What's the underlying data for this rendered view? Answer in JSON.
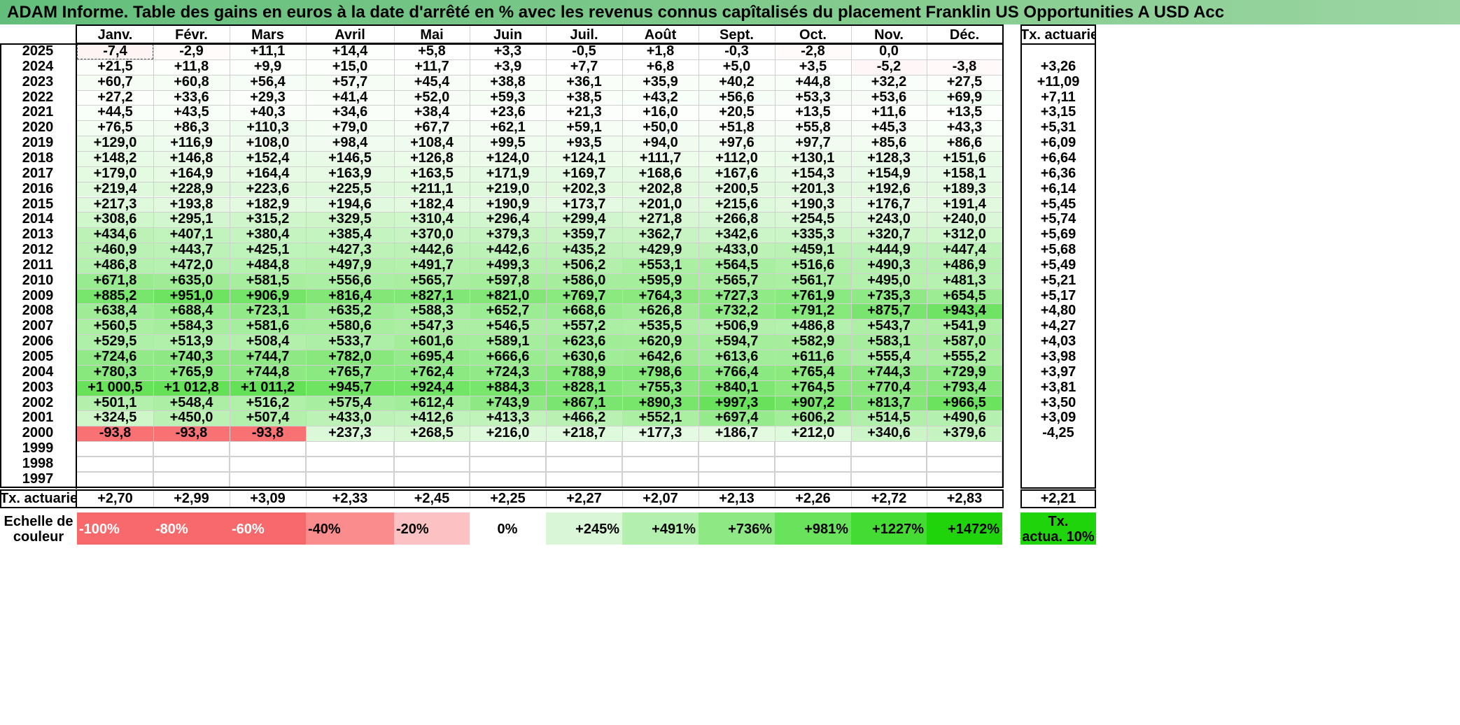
{
  "title": "ADAM Informe. Table des gains en euros à la date d'arrêté en % avec les revenus connus capîtalisés du placement Franklin US Opportunities A USD Acc",
  "months": [
    "Janv.",
    "Févr.",
    "Mars",
    "Avril",
    "Mai",
    "Juin",
    "Juil.",
    "Août",
    "Sept.",
    "Oct.",
    "Nov.",
    "Déc."
  ],
  "tx_header": "Tx. actuariel",
  "rows": [
    {
      "year": "2025",
      "values": [
        "-7,4",
        "-2,9",
        "+11,1",
        "+14,4",
        "+5,8",
        "+3,3",
        "-0,5",
        "+1,8",
        "-0,3",
        "-2,8",
        "0,0",
        ""
      ],
      "tx": ""
    },
    {
      "year": "2024",
      "values": [
        "+21,5",
        "+11,8",
        "+9,9",
        "+15,0",
        "+11,7",
        "+3,9",
        "+7,7",
        "+6,8",
        "+5,0",
        "+3,5",
        "-5,2",
        "-3,8"
      ],
      "tx": "+3,26"
    },
    {
      "year": "2023",
      "values": [
        "+60,7",
        "+60,8",
        "+56,4",
        "+57,7",
        "+45,4",
        "+38,8",
        "+36,1",
        "+35,9",
        "+40,2",
        "+44,8",
        "+32,2",
        "+27,5"
      ],
      "tx": "+11,09"
    },
    {
      "year": "2022",
      "values": [
        "+27,2",
        "+33,6",
        "+29,3",
        "+41,4",
        "+52,0",
        "+59,3",
        "+38,5",
        "+43,2",
        "+56,6",
        "+53,3",
        "+53,6",
        "+69,9"
      ],
      "tx": "+7,11"
    },
    {
      "year": "2021",
      "values": [
        "+44,5",
        "+43,5",
        "+40,3",
        "+34,6",
        "+38,4",
        "+23,6",
        "+21,3",
        "+16,0",
        "+20,5",
        "+13,5",
        "+11,6",
        "+13,5"
      ],
      "tx": "+3,15"
    },
    {
      "year": "2020",
      "values": [
        "+76,5",
        "+86,3",
        "+110,3",
        "+79,0",
        "+67,7",
        "+62,1",
        "+59,1",
        "+50,0",
        "+51,8",
        "+55,8",
        "+45,3",
        "+43,3"
      ],
      "tx": "+5,31"
    },
    {
      "year": "2019",
      "values": [
        "+129,0",
        "+116,9",
        "+108,0",
        "+98,4",
        "+108,4",
        "+99,5",
        "+93,5",
        "+94,0",
        "+97,6",
        "+97,7",
        "+85,6",
        "+86,6"
      ],
      "tx": "+6,09"
    },
    {
      "year": "2018",
      "values": [
        "+148,2",
        "+146,8",
        "+152,4",
        "+146,5",
        "+126,8",
        "+124,0",
        "+124,1",
        "+111,7",
        "+112,0",
        "+130,1",
        "+128,3",
        "+151,6"
      ],
      "tx": "+6,64"
    },
    {
      "year": "2017",
      "values": [
        "+179,0",
        "+164,9",
        "+164,4",
        "+163,9",
        "+163,5",
        "+171,9",
        "+169,7",
        "+168,6",
        "+167,6",
        "+154,3",
        "+154,9",
        "+158,1"
      ],
      "tx": "+6,36"
    },
    {
      "year": "2016",
      "values": [
        "+219,4",
        "+228,9",
        "+223,6",
        "+225,5",
        "+211,1",
        "+219,0",
        "+202,3",
        "+202,8",
        "+200,5",
        "+201,3",
        "+192,6",
        "+189,3"
      ],
      "tx": "+6,14"
    },
    {
      "year": "2015",
      "values": [
        "+217,3",
        "+193,8",
        "+182,9",
        "+194,6",
        "+182,4",
        "+190,9",
        "+173,7",
        "+201,0",
        "+215,6",
        "+190,3",
        "+176,7",
        "+191,4"
      ],
      "tx": "+5,45"
    },
    {
      "year": "2014",
      "values": [
        "+308,6",
        "+295,1",
        "+315,2",
        "+329,5",
        "+310,4",
        "+296,4",
        "+299,4",
        "+271,8",
        "+266,8",
        "+254,5",
        "+243,0",
        "+240,0"
      ],
      "tx": "+5,74"
    },
    {
      "year": "2013",
      "values": [
        "+434,6",
        "+407,1",
        "+380,4",
        "+385,4",
        "+370,0",
        "+379,3",
        "+359,7",
        "+362,7",
        "+342,6",
        "+335,3",
        "+320,7",
        "+312,0"
      ],
      "tx": "+5,69"
    },
    {
      "year": "2012",
      "values": [
        "+460,9",
        "+443,7",
        "+425,1",
        "+427,3",
        "+442,6",
        "+442,6",
        "+435,2",
        "+429,9",
        "+433,0",
        "+459,1",
        "+444,9",
        "+447,4"
      ],
      "tx": "+5,68"
    },
    {
      "year": "2011",
      "values": [
        "+486,8",
        "+472,0",
        "+484,8",
        "+497,9",
        "+491,7",
        "+499,3",
        "+506,2",
        "+553,1",
        "+564,5",
        "+516,6",
        "+490,3",
        "+486,9"
      ],
      "tx": "+5,49"
    },
    {
      "year": "2010",
      "values": [
        "+671,8",
        "+635,0",
        "+581,5",
        "+556,6",
        "+565,7",
        "+597,8",
        "+586,0",
        "+595,9",
        "+565,7",
        "+561,7",
        "+495,0",
        "+481,3"
      ],
      "tx": "+5,21"
    },
    {
      "year": "2009",
      "values": [
        "+885,2",
        "+951,0",
        "+906,9",
        "+816,4",
        "+827,1",
        "+821,0",
        "+769,7",
        "+764,3",
        "+727,3",
        "+761,9",
        "+735,3",
        "+654,5"
      ],
      "tx": "+5,17"
    },
    {
      "year": "2008",
      "values": [
        "+638,4",
        "+688,4",
        "+723,1",
        "+635,2",
        "+588,3",
        "+652,7",
        "+668,6",
        "+626,8",
        "+732,2",
        "+791,2",
        "+875,7",
        "+943,4"
      ],
      "tx": "+4,80"
    },
    {
      "year": "2007",
      "values": [
        "+560,5",
        "+584,3",
        "+581,6",
        "+580,6",
        "+547,3",
        "+546,5",
        "+557,2",
        "+535,5",
        "+506,9",
        "+486,8",
        "+543,7",
        "+541,9"
      ],
      "tx": "+4,27"
    },
    {
      "year": "2006",
      "values": [
        "+529,5",
        "+513,9",
        "+508,4",
        "+533,7",
        "+601,6",
        "+589,1",
        "+623,6",
        "+620,9",
        "+594,7",
        "+582,9",
        "+583,1",
        "+587,0"
      ],
      "tx": "+4,03"
    },
    {
      "year": "2005",
      "values": [
        "+724,6",
        "+740,3",
        "+744,7",
        "+782,0",
        "+695,4",
        "+666,6",
        "+630,6",
        "+642,6",
        "+613,6",
        "+611,6",
        "+555,4",
        "+555,2"
      ],
      "tx": "+3,98"
    },
    {
      "year": "2004",
      "values": [
        "+780,3",
        "+765,9",
        "+744,8",
        "+765,7",
        "+762,4",
        "+724,3",
        "+788,9",
        "+798,6",
        "+766,4",
        "+765,4",
        "+744,3",
        "+729,9"
      ],
      "tx": "+3,97"
    },
    {
      "year": "2003",
      "values": [
        "+1 000,5",
        "+1 012,8",
        "+1 011,2",
        "+945,7",
        "+924,4",
        "+884,3",
        "+828,1",
        "+755,3",
        "+840,1",
        "+764,5",
        "+770,4",
        "+793,4"
      ],
      "tx": "+3,81"
    },
    {
      "year": "2002",
      "values": [
        "+501,1",
        "+548,4",
        "+516,2",
        "+575,4",
        "+612,4",
        "+743,9",
        "+867,1",
        "+890,3",
        "+997,3",
        "+907,2",
        "+813,7",
        "+966,5"
      ],
      "tx": "+3,50"
    },
    {
      "year": "2001",
      "values": [
        "+324,5",
        "+450,0",
        "+507,4",
        "+433,0",
        "+412,6",
        "+413,3",
        "+466,2",
        "+552,1",
        "+697,4",
        "+606,2",
        "+514,5",
        "+490,6"
      ],
      "tx": "+3,09"
    },
    {
      "year": "2000",
      "values": [
        "-93,8",
        "-93,8",
        "-93,8",
        "+237,3",
        "+268,5",
        "+216,0",
        "+218,7",
        "+177,3",
        "+186,7",
        "+212,0",
        "+340,6",
        "+379,6"
      ],
      "tx": "-4,25"
    },
    {
      "year": "1999",
      "values": [
        "",
        "",
        "",
        "",
        "",
        "",
        "",
        "",
        "",
        "",
        "",
        ""
      ],
      "tx": ""
    },
    {
      "year": "1998",
      "values": [
        "",
        "",
        "",
        "",
        "",
        "",
        "",
        "",
        "",
        "",
        "",
        ""
      ],
      "tx": ""
    },
    {
      "year": "1997",
      "values": [
        "",
        "",
        "",
        "",
        "",
        "",
        "",
        "",
        "",
        "",
        "",
        ""
      ],
      "tx": ""
    }
  ],
  "footer": {
    "label": "Tx. actuariel",
    "values": [
      "+2,70",
      "+2,99",
      "+3,09",
      "+2,33",
      "+2,45",
      "+2,25",
      "+2,27",
      "+2,07",
      "+2,13",
      "+2,26",
      "+2,72",
      "+2,83"
    ],
    "tx": "+2,21"
  },
  "scale": {
    "label_line1": "Echelle de",
    "label_line2": "couleur",
    "items": [
      {
        "text": "-100%",
        "color": "#f8696b",
        "align": "left"
      },
      {
        "text": "-80%",
        "color": "#f8696b",
        "align": "left"
      },
      {
        "text": "-60%",
        "color": "#f8696b",
        "align": "left"
      },
      {
        "text": "-40%",
        "color": "#fb8c8e",
        "align": "left"
      },
      {
        "text": "-20%",
        "color": "#fcc2c3",
        "align": "left"
      },
      {
        "text": "0%",
        "color": "#ffffff",
        "align": "center"
      },
      {
        "text": "+245%",
        "color": "#d9f7d6",
        "align": "right"
      },
      {
        "text": "+491%",
        "color": "#b4f0ad",
        "align": "right"
      },
      {
        "text": "+736%",
        "color": "#8ee985",
        "align": "right"
      },
      {
        "text": "+981%",
        "color": "#69e25c",
        "align": "right"
      },
      {
        "text": "+1227%",
        "color": "#44db33",
        "align": "right"
      },
      {
        "text": "+1472%",
        "color": "#1fd40b",
        "align": "right"
      }
    ],
    "tx_line1": "Tx.",
    "tx_line2": "actua. 10%",
    "tx_color": "#1fd40b"
  },
  "colors": {
    "negative_max": "#f8696b",
    "positive_max": "#1fd40b",
    "title_bar": "#63be7b"
  }
}
